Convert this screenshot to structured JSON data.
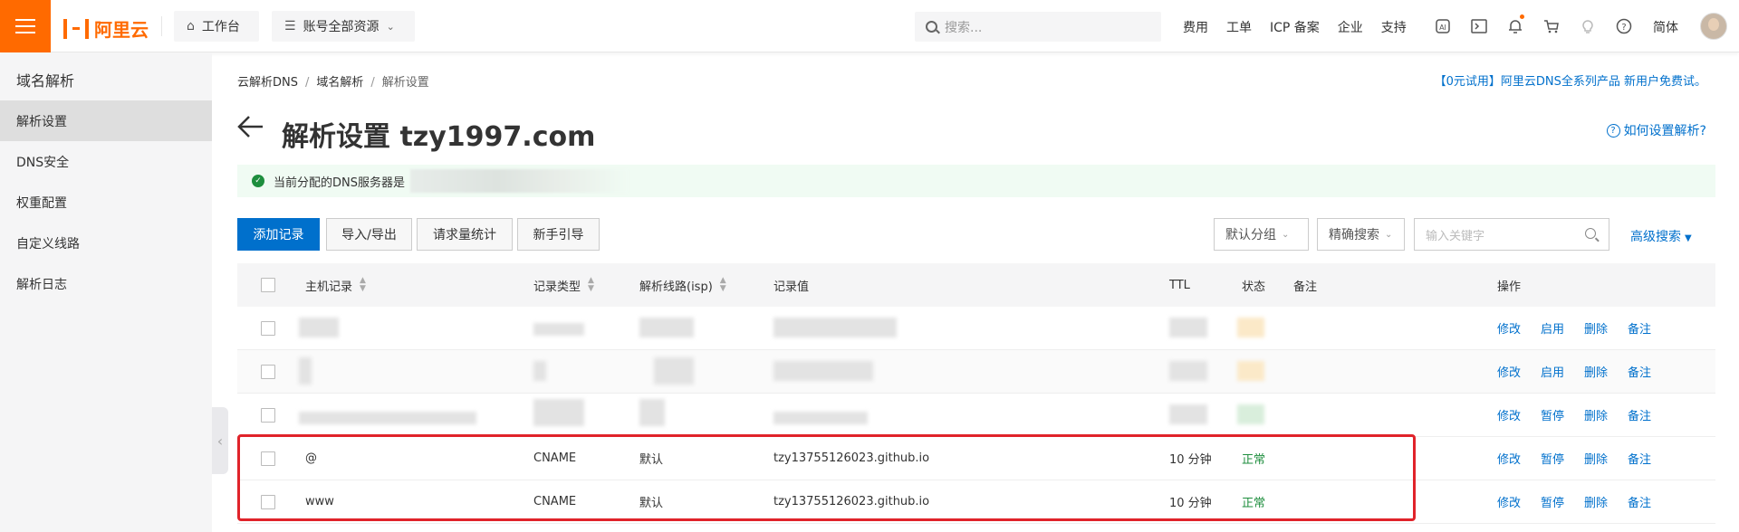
{
  "topbar": {
    "brand": "阿里云",
    "workbench": "工作台",
    "resources": "账号全部资源",
    "search_placeholder": "搜索...",
    "links": [
      "费用",
      "工单",
      "ICP 备案",
      "企业",
      "支持"
    ],
    "lang": "简体"
  },
  "sidebar": {
    "title": "域名解析",
    "items": [
      "解析设置",
      "DNS安全",
      "权重配置",
      "自定义线路",
      "解析日志"
    ],
    "active_index": 0
  },
  "breadcrumb": [
    "云解析DNS",
    "域名解析",
    "解析设置"
  ],
  "promo": "【0元试用】阿里云DNS全系列产品 新用户免费试。",
  "page_title": "解析设置 tzy1997.com",
  "help_link": "如何设置解析?",
  "notice": "当前分配的DNS服务器是",
  "toolbar": {
    "add": "添加记录",
    "import_export": "导入/导出",
    "stats": "请求量统计",
    "guide": "新手引导",
    "group": "默认分组",
    "match": "精确搜索",
    "keyword_placeholder": "输入关键字",
    "advanced": "高级搜索"
  },
  "table": {
    "headers": {
      "host": "主机记录",
      "type": "记录类型",
      "line": "解析线路(isp)",
      "value": "记录值",
      "ttl": "TTL",
      "status": "状态",
      "remark": "备注",
      "ops": "操作"
    },
    "rows": [
      {
        "blurred": true,
        "ops": [
          "修改",
          "启用",
          "删除",
          "备注"
        ]
      },
      {
        "blurred": true,
        "ops": [
          "修改",
          "启用",
          "删除",
          "备注"
        ]
      },
      {
        "blurred": true,
        "ops": [
          "修改",
          "暂停",
          "删除",
          "备注"
        ]
      },
      {
        "blurred": false,
        "host": "@",
        "type": "CNAME",
        "line": "默认",
        "value": "tzy13755126023.github.io",
        "ttl": "10 分钟",
        "status": "正常",
        "ops": [
          "修改",
          "暂停",
          "删除",
          "备注"
        ]
      },
      {
        "blurred": false,
        "host": "www",
        "type": "CNAME",
        "line": "默认",
        "value": "tzy13755126023.github.io",
        "ttl": "10 分钟",
        "status": "正常",
        "ops": [
          "修改",
          "暂停",
          "删除",
          "备注"
        ]
      }
    ]
  },
  "colors": {
    "brand": "#ff6a00",
    "link": "#0070cc",
    "success": "#1e8e3e",
    "highlight": "#e0232a"
  }
}
